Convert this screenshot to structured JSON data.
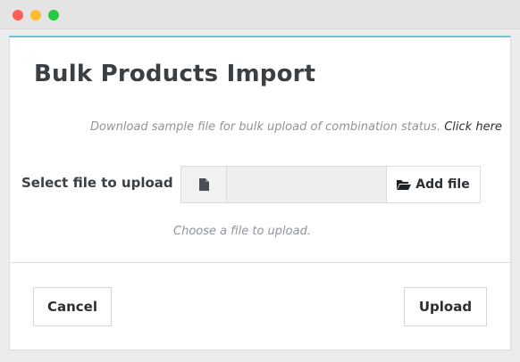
{
  "window": {
    "controls": [
      "close",
      "minimize",
      "zoom"
    ]
  },
  "modal": {
    "title": "Bulk Products Import",
    "accent_color": "#6cc3d5",
    "hint_text": "Download sample file for bulk upload of combination status.",
    "hint_link": "Click here",
    "field_label": "Select file to upload",
    "file_input": {
      "value": "",
      "placeholder": ""
    },
    "add_file_label": "Add file",
    "help_text": "Choose a file to upload.",
    "cancel_label": "Cancel",
    "upload_label": "Upload"
  },
  "icons": {
    "file": "file-icon",
    "folder": "folder-open-icon"
  }
}
